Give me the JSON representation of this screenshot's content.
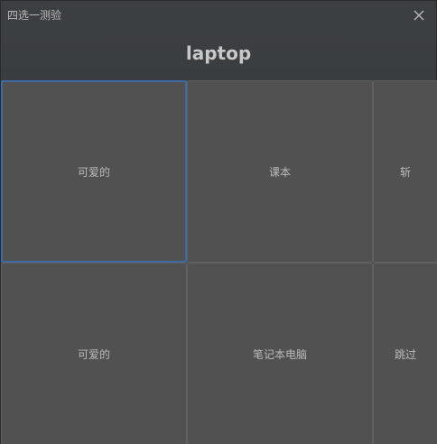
{
  "window": {
    "title": "四选一测验"
  },
  "quiz": {
    "word": "laptop"
  },
  "options": [
    {
      "label": "可爱的"
    },
    {
      "label": "课本"
    },
    {
      "label": "斩"
    },
    {
      "label": "可爱的"
    },
    {
      "label": "笔记本电脑"
    },
    {
      "label": "跳过"
    }
  ],
  "colors": {
    "background": "#3c3f41",
    "button": "#515151",
    "focus_border": "#3e6ba5",
    "text": "#bbbbbb"
  },
  "icons": {
    "close": "close-icon"
  }
}
